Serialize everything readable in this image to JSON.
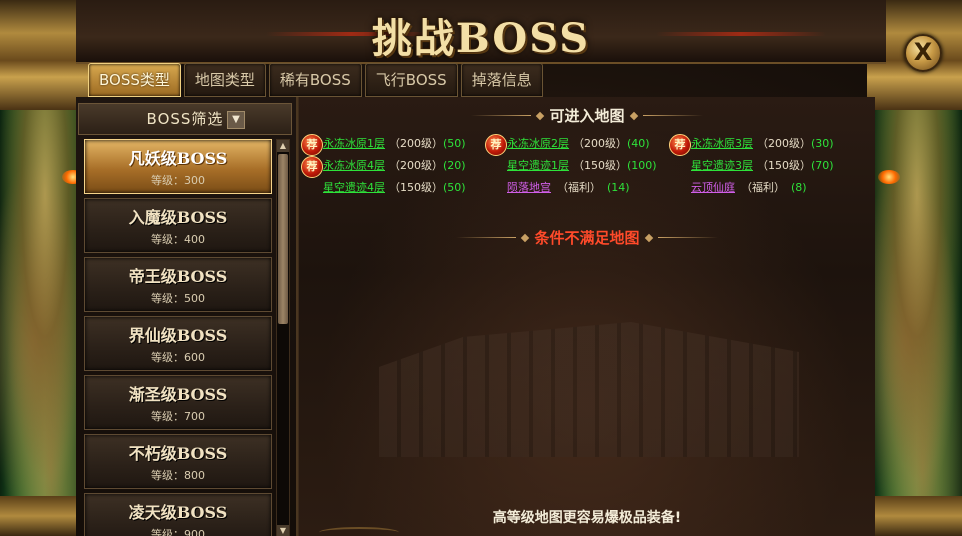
{
  "window": {
    "title": "挑战BOSS",
    "close_label": "X"
  },
  "tabs": [
    {
      "label": "BOSS类型",
      "active": true
    },
    {
      "label": "地图类型",
      "active": false
    },
    {
      "label": "稀有BOSS",
      "active": false
    },
    {
      "label": "飞行BOSS",
      "active": false
    },
    {
      "label": "掉落信息",
      "active": false
    }
  ],
  "filter": {
    "label": "BOSS筛选",
    "dropdown_icon": "▼"
  },
  "boss_list": [
    {
      "name": "凡妖级BOSS",
      "level": "等级：300",
      "active": true
    },
    {
      "name": "入魔级BOSS",
      "level": "等级：400",
      "active": false
    },
    {
      "name": "帝王级BOSS",
      "level": "等级：500",
      "active": false
    },
    {
      "name": "界仙级BOSS",
      "level": "等级：600",
      "active": false
    },
    {
      "name": "渐圣级BOSS",
      "level": "等级：700",
      "active": false
    },
    {
      "name": "不朽级BOSS",
      "level": "等级：800",
      "active": false
    },
    {
      "name": "凌天级BOSS",
      "level": "等级：900",
      "active": false
    }
  ],
  "scrollbar": {
    "up_icon": "▲",
    "down_icon": "▼"
  },
  "sections": {
    "accessible": "可进入地图",
    "unmet": "条件不满足地图"
  },
  "rec_badge_text": "荐",
  "maps": [
    [
      {
        "name": "永冻冰原1层",
        "req": "（200级）",
        "count": "(50)",
        "rec": true,
        "color": "green"
      },
      {
        "name": "永冻冰原2层",
        "req": "（200级）",
        "count": "(40)",
        "rec": true,
        "color": "green"
      },
      {
        "name": "永冻冰原3层",
        "req": "（200级）",
        "count": "(30)",
        "rec": true,
        "color": "green"
      }
    ],
    [
      {
        "name": "永冻冰原4层",
        "req": "（200级）",
        "count": "(20)",
        "rec": true,
        "color": "green"
      },
      {
        "name": "星空遗迹1层",
        "req": "（150级）",
        "count": "(100)",
        "rec": false,
        "color": "green"
      },
      {
        "name": "星空遗迹3层",
        "req": "（150级）",
        "count": "(70)",
        "rec": false,
        "color": "green"
      }
    ],
    [
      {
        "name": "星空遗迹4层",
        "req": "（150级）",
        "count": "(50)",
        "rec": false,
        "color": "green"
      },
      {
        "name": "陨落地宫",
        "req": "（福利）",
        "count": "(14)",
        "rec": false,
        "color": "purple"
      },
      {
        "name": "云顶仙庭",
        "req": "（福利）",
        "count": "(8)",
        "rec": false,
        "color": "purple"
      }
    ]
  ],
  "footer_tip": "高等级地图更容易爆极品装备!",
  "colors": {
    "accent_gold": "#d8a94f",
    "map_green": "#2ee23a",
    "map_purple": "#d05ee8",
    "warning_red": "#ff4a2a"
  }
}
